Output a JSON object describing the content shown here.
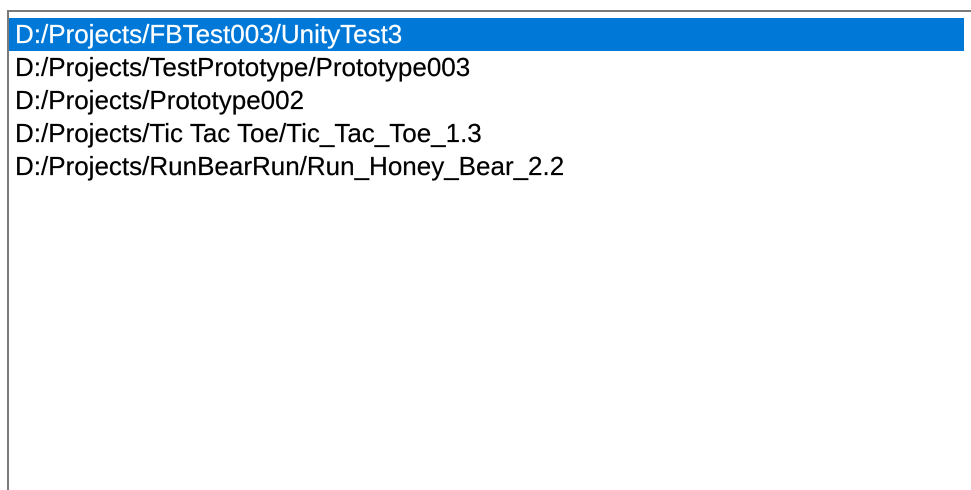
{
  "listbox": {
    "selected_index": 0,
    "items": [
      {
        "label": "D:/Projects/FBTest003/UnityTest3"
      },
      {
        "label": "D:/Projects/TestPrototype/Prototype003"
      },
      {
        "label": "D:/Projects/Prototype002"
      },
      {
        "label": "D:/Projects/Tic Tac Toe/Tic_Tac_Toe_1.3"
      },
      {
        "label": "D:/Projects/RunBearRun/Run_Honey_Bear_2.2"
      }
    ]
  },
  "colors": {
    "selection_background": "#0078d7",
    "selection_text": "#ffffff",
    "text": "#000000",
    "border": "#7a7a7a"
  }
}
